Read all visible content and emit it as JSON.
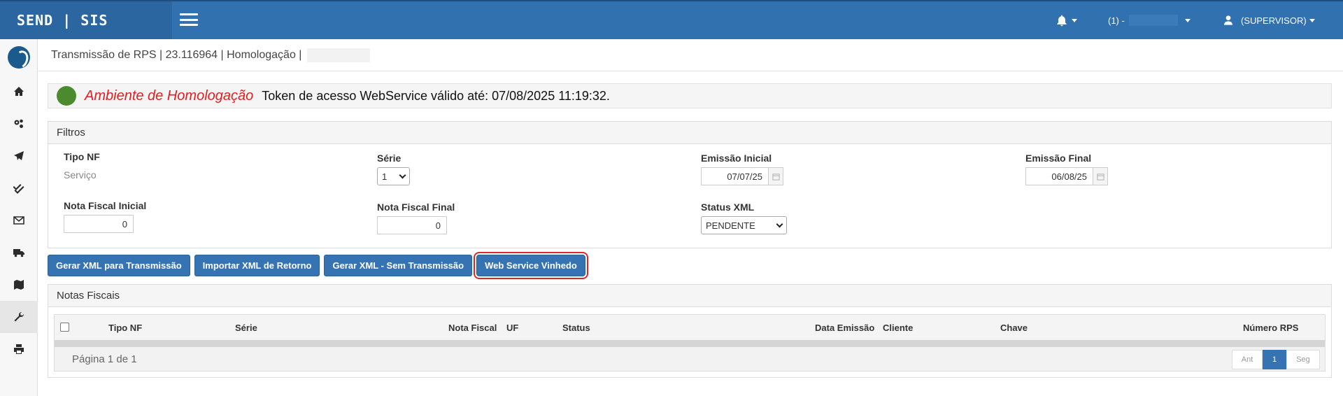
{
  "header": {
    "brand": "SEND | SIS",
    "company_prefix": "(1) -",
    "user_label": "(SUPERVISOR)"
  },
  "breadcrumb": {
    "text": "Transmissão de RPS | 23.116964 | Homologação |"
  },
  "environment": {
    "name": "Ambiente de Homologação",
    "token_text": "Token de acesso WebService válido até: 07/08/2025 11:19:32.",
    "status_color": "#4b8a2d"
  },
  "filters": {
    "title": "Filtros",
    "tipo_nf": {
      "label": "Tipo NF",
      "value": "Serviço"
    },
    "serie": {
      "label": "Série",
      "value": "1"
    },
    "emissao_inicial": {
      "label": "Emissão Inicial",
      "value": "07/07/25"
    },
    "emissao_final": {
      "label": "Emissão Final",
      "value": "06/08/25"
    },
    "nf_inicial": {
      "label": "Nota Fiscal Inicial",
      "value": "0"
    },
    "nf_final": {
      "label": "Nota Fiscal Final",
      "value": "0"
    },
    "status_xml": {
      "label": "Status XML",
      "value": "PENDENTE"
    }
  },
  "actions": {
    "gerar_xml": "Gerar XML para Transmissão",
    "importar_xml": "Importar XML de Retorno",
    "gerar_sem": "Gerar XML - Sem Transmissão",
    "web_service": "Web Service Vinhedo"
  },
  "notas": {
    "title": "Notas Fiscais",
    "columns": [
      "Tipo NF",
      "Série",
      "Nota Fiscal",
      "UF",
      "Status",
      "Data Emissão",
      "Cliente",
      "Chave",
      "Número RPS"
    ],
    "page_info": "Página 1 de 1",
    "pager": {
      "prev": "Ant",
      "current": "1",
      "next": "Seg"
    }
  },
  "colors": {
    "primary": "#3171b0",
    "button": "#3673b3",
    "highlight": "#d42a2a"
  }
}
